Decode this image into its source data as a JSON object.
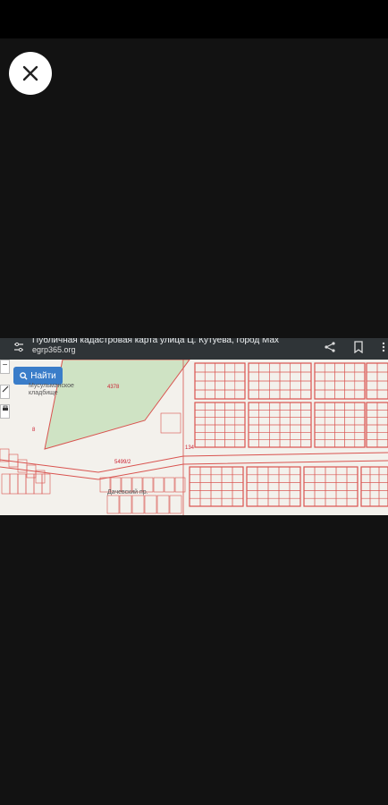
{
  "viewer": {
    "close_icon": "close-icon"
  },
  "browser": {
    "title": "Публичная кадастровая карта улица Ц. Кутуева, город Мах",
    "url": "egrp365.org",
    "icons": [
      "tune-icon",
      "share-icon",
      "bookmark-icon",
      "more-vertical-icon"
    ]
  },
  "map": {
    "find_label": "Найти",
    "search_icon": "search-icon",
    "zoom_out_label": "−",
    "labels": {
      "cemetery": "Мусульманское кладбище",
      "parcel_4378": "4378",
      "parcel_5499": "5499/2",
      "parcel_134": "134",
      "street": "Дачевский пр.",
      "parcel_1": "8"
    },
    "colors": {
      "parcel_line": "#d9534f",
      "green_zone": "#cfe3c4",
      "background": "#f3f1ec",
      "button": "#3a7dc9"
    }
  }
}
